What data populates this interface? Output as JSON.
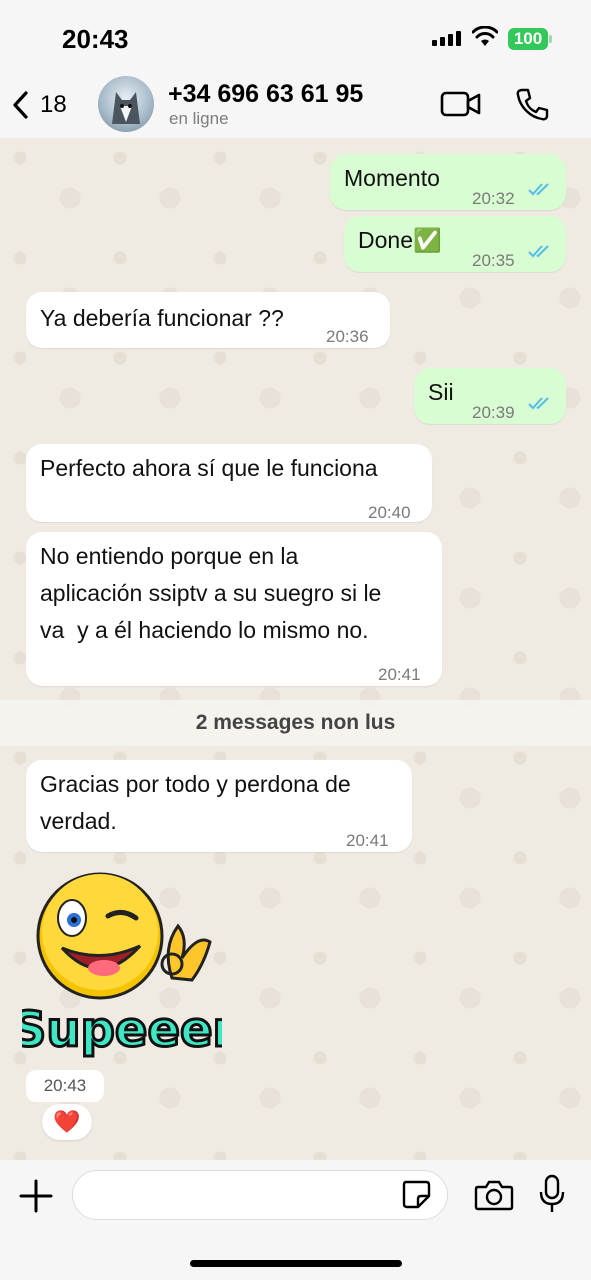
{
  "status_bar": {
    "time": "20:43",
    "battery": "100"
  },
  "header": {
    "back_count": "18",
    "contact_name": "+34 696 63 61 95",
    "contact_status": "en ligne"
  },
  "messages": [
    {
      "direction": "out",
      "text": "Momento",
      "time": "20:32",
      "read": true
    },
    {
      "direction": "out",
      "text": "Done✅",
      "time": "20:35",
      "read": true
    },
    {
      "direction": "in",
      "text": "Ya debería funcionar ??",
      "time": "20:36"
    },
    {
      "direction": "out",
      "text": "Sii",
      "time": "20:39",
      "read": true
    },
    {
      "direction": "in",
      "text": "Perfecto ahora sí que le funciona",
      "time": "20:40"
    },
    {
      "direction": "in",
      "lines": [
        "No entiendo porque en la",
        "aplicación ssiptv a su suegro si le",
        "va  y a él haciendo lo mismo no."
      ],
      "time": "20:41"
    },
    {
      "direction": "in",
      "lines": [
        "Gracias por todo y perdona de",
        "verdad."
      ],
      "time": "20:41"
    }
  ],
  "unread_divider": "2 messages non lus",
  "sticker": {
    "text": "Supeeer",
    "time": "20:43",
    "reaction": "❤️"
  },
  "icons": {
    "back": "chevron-left-icon",
    "video": "video-call-icon",
    "call": "phone-icon",
    "plus": "plus-icon",
    "sticker": "sticker-icon",
    "camera": "camera-icon",
    "mic": "microphone-icon"
  },
  "colors": {
    "outgoing_bubble": "#d9fdd3",
    "incoming_bubble": "#ffffff",
    "read_ticks": "#53bdeb",
    "battery": "#34c759"
  }
}
